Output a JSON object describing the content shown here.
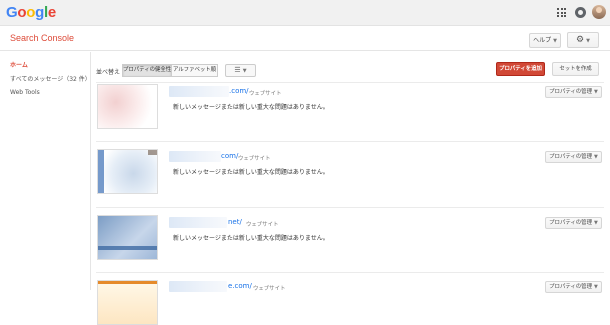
{
  "header": {
    "logo_letters": [
      {
        "ch": "G",
        "cls": "b"
      },
      {
        "ch": "o",
        "cls": "r"
      },
      {
        "ch": "o",
        "cls": "y"
      },
      {
        "ch": "g",
        "cls": "b"
      },
      {
        "ch": "l",
        "cls": "g"
      },
      {
        "ch": "e",
        "cls": "r"
      }
    ],
    "icons": [
      "apps-icon",
      "notifications-icon",
      "account-avatar"
    ]
  },
  "product": {
    "title": "Search Console"
  },
  "toolbar": {
    "help_label": "ヘルプ",
    "settings_icon": "gear-icon"
  },
  "sidebar": {
    "items": [
      {
        "label": "ホーム",
        "active": true
      },
      {
        "label": "すべてのメッセージ（32 件）",
        "active": false
      },
      {
        "label": "Web Tools",
        "active": false
      }
    ]
  },
  "main": {
    "sort_label": "並べ替え",
    "sort_options": [
      "プロパティの健全性",
      "アルファベット順"
    ],
    "sort_selected": "プロパティの健全性",
    "view_icon": "list-view-icon",
    "add_property_label": "プロパティを追加",
    "create_set_label": "セットを作成",
    "properties": [
      {
        "url": ".com/",
        "type": "ウェブサイト",
        "message": "新しいメッセージまたは新しい重大な問題はありません。",
        "manage_label": "プロパティの管理"
      },
      {
        "url": "com/",
        "type": "ウェブサイト",
        "message": "新しいメッセージまたは新しい重大な問題はありません。",
        "manage_label": "プロパティの管理"
      },
      {
        "url": "net/",
        "type": "ウェブサイト",
        "message": "新しいメッセージまたは新しい重大な問題はありません。",
        "manage_label": "プロパティの管理"
      },
      {
        "url": "e.com/",
        "type": "ウェブサイト",
        "message": "",
        "manage_label": "プロパティの管理"
      }
    ]
  },
  "colors": {
    "brand_red": "#dd4b39",
    "primary_button": "#d14836",
    "link_blue": "#1a73e8"
  }
}
